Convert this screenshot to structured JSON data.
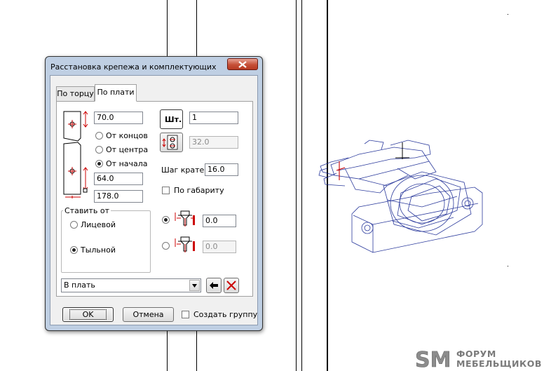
{
  "dialog": {
    "title": "Расстановка крепежа и комплектующих",
    "tabs": [
      {
        "label": "По торцу",
        "active": false
      },
      {
        "label": "По плати",
        "active": true
      }
    ],
    "top_offset": "70.0",
    "from_options": [
      {
        "label": "От концов",
        "selected": false
      },
      {
        "label": "От центра",
        "selected": false
      },
      {
        "label": "От начала",
        "selected": true
      }
    ],
    "second_offset": "64.0",
    "length": "178.0",
    "place_from": {
      "title": "Ставить от",
      "options": [
        {
          "label": "Лицевой",
          "selected": false
        },
        {
          "label": "Тыльной",
          "selected": true
        }
      ]
    },
    "count_label": "Шт.",
    "count_value": "1",
    "pitch_value": "32.0",
    "multiple_step_label": "Шаг кратен",
    "multiple_step_value": "16.0",
    "by_size_label": "По габариту",
    "by_size_checked": false,
    "depth_options": [
      {
        "value": "0.0",
        "selected": true,
        "enabled": true
      },
      {
        "value": "0.0",
        "selected": false,
        "enabled": false
      }
    ],
    "component_select": "В плать",
    "ok_label": "OK",
    "cancel_label": "Отмена",
    "create_group_label": "Создать группу",
    "create_group_checked": false
  },
  "watermark": {
    "logo_letters": "SM",
    "line1": "ФОРУМ",
    "line2": "МЕБЕЛЬЩИКОВ"
  },
  "colors": {
    "accent": "#c65038",
    "frame": "#bfcfe3",
    "wireframe": "#2b3a9c",
    "marker_red": "#cc0000"
  }
}
